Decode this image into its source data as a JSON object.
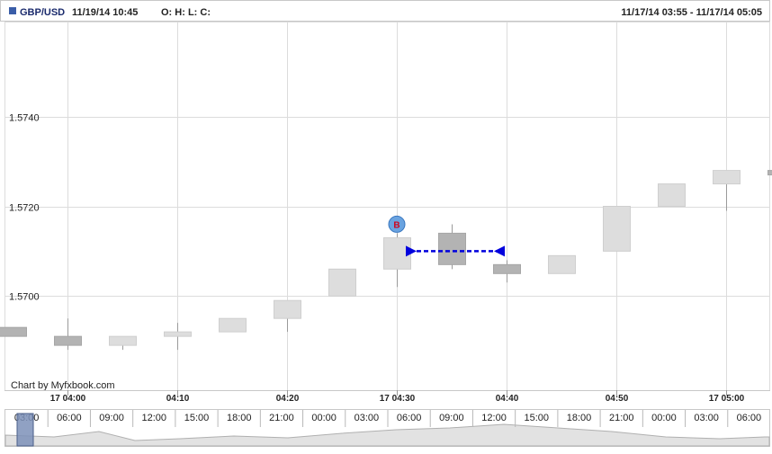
{
  "header": {
    "symbol": "GBP/USD",
    "datetime": "11/19/14 10:45",
    "ohlc_label": "O: H: L: C:",
    "range": "11/17/14 03:55 - 11/17/14 05:05",
    "symbol_marker_color": "#3a5da8"
  },
  "credit": "Chart by Myfxbook.com",
  "colors": {
    "bull_fill": "#dddddd",
    "bear_fill": "#b3b3b3",
    "trade_line": "#0000dd",
    "marker_fill": "#6aa3e0",
    "marker_text": "#d0021b"
  },
  "chart_data": {
    "type": "candlestick",
    "y_ticks": [
      "1.5700",
      "1.5720",
      "1.5740"
    ],
    "ylim": [
      1.5679,
      1.5761
    ],
    "x_tick_labels": [
      "17 04:00",
      "04:10",
      "04:20",
      "17 04:30",
      "04:40",
      "04:50",
      "17 05:00"
    ],
    "grid": true,
    "candles": [
      {
        "time": "03:55",
        "o": 1.5693,
        "h": 1.5693,
        "l": 1.5691,
        "c": 1.5691
      },
      {
        "time": "04:00",
        "o": 1.5691,
        "h": 1.5695,
        "l": 1.5688,
        "c": 1.5689
      },
      {
        "time": "04:05",
        "o": 1.5689,
        "h": 1.5691,
        "l": 1.5688,
        "c": 1.5691
      },
      {
        "time": "04:10",
        "o": 1.5691,
        "h": 1.5694,
        "l": 1.5688,
        "c": 1.5692
      },
      {
        "time": "04:15",
        "o": 1.5692,
        "h": 1.5695,
        "l": 1.5692,
        "c": 1.5695
      },
      {
        "time": "04:20",
        "o": 1.5695,
        "h": 1.5699,
        "l": 1.5692,
        "c": 1.5699
      },
      {
        "time": "04:25",
        "o": 1.57,
        "h": 1.5706,
        "l": 1.57,
        "c": 1.5706
      },
      {
        "time": "04:30",
        "o": 1.5706,
        "h": 1.5714,
        "l": 1.5702,
        "c": 1.5713
      },
      {
        "time": "04:35",
        "o": 1.5714,
        "h": 1.5716,
        "l": 1.5706,
        "c": 1.5707
      },
      {
        "time": "04:40",
        "o": 1.5707,
        "h": 1.5708,
        "l": 1.5703,
        "c": 1.5705
      },
      {
        "time": "04:45",
        "o": 1.5705,
        "h": 1.5709,
        "l": 1.5705,
        "c": 1.5709
      },
      {
        "time": "04:50",
        "o": 1.571,
        "h": 1.572,
        "l": 1.571,
        "c": 1.572
      },
      {
        "time": "04:55",
        "o": 1.572,
        "h": 1.5725,
        "l": 1.572,
        "c": 1.5725
      },
      {
        "time": "05:00",
        "o": 1.5725,
        "h": 1.5728,
        "l": 1.5719,
        "c": 1.5728
      },
      {
        "time": "05:05",
        "o": 1.5728,
        "h": 1.5735,
        "l": 1.5726,
        "c": 1.5727
      }
    ],
    "trade": {
      "label": "B",
      "price": 1.571,
      "entry_time": "04:30",
      "exit_time": "04:40"
    },
    "navigator": {
      "labels": [
        "03:00",
        "06:00",
        "09:00",
        "12:00",
        "15:00",
        "18:00",
        "21:00",
        "00:00",
        "03:00",
        "06:00",
        "09:00",
        "12:00",
        "15:00",
        "18:00",
        "21:00",
        "00:00",
        "03:00",
        "06:00"
      ]
    }
  }
}
